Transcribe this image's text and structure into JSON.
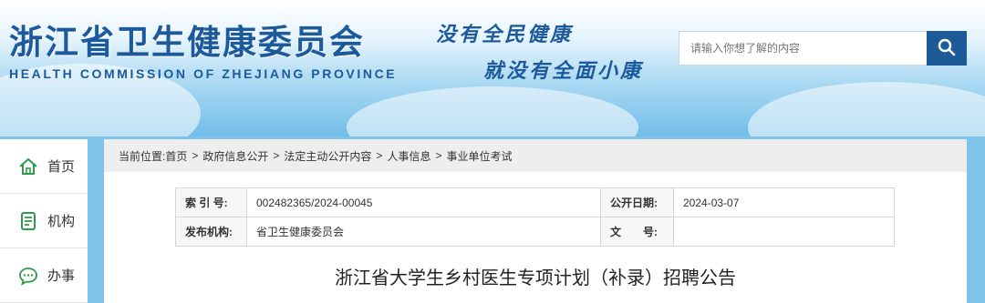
{
  "header": {
    "title_cn": "浙江省卫生健康委员会",
    "title_en": "HEALTH COMMISSION OF ZHEJIANG PROVINCE",
    "slogan_line1": "没有全民健康",
    "slogan_line2": "就没有全面小康",
    "search": {
      "placeholder": "请输入你想了解的内容",
      "icon": "search-icon"
    }
  },
  "sidebar": {
    "items": [
      {
        "label": "首页",
        "icon": "home-icon"
      },
      {
        "label": "机构",
        "icon": "org-icon"
      },
      {
        "label": "办事",
        "icon": "service-icon"
      }
    ]
  },
  "breadcrumb": {
    "prefix": "当前位置:",
    "items": [
      "首页",
      "政府信息公开",
      "法定主动公开内容",
      "人事信息",
      "事业单位考试"
    ],
    "separator": ">"
  },
  "meta": {
    "index_label": "索 引 号:",
    "index_value": "002482365/2024-00045",
    "date_label": "公开日期:",
    "date_value": "2024-03-07",
    "issuer_label": "发布机构:",
    "issuer_value": "省卫生健康委员会",
    "docno_label": "文　　号:",
    "docno_value": ""
  },
  "article": {
    "title": "浙江省大学生乡村医生专项计划（补录）招聘公告"
  },
  "colors": {
    "brand_blue": "#1c5a9c",
    "search_button": "#1d5a98",
    "sky_blue": "#7fc3ea"
  }
}
